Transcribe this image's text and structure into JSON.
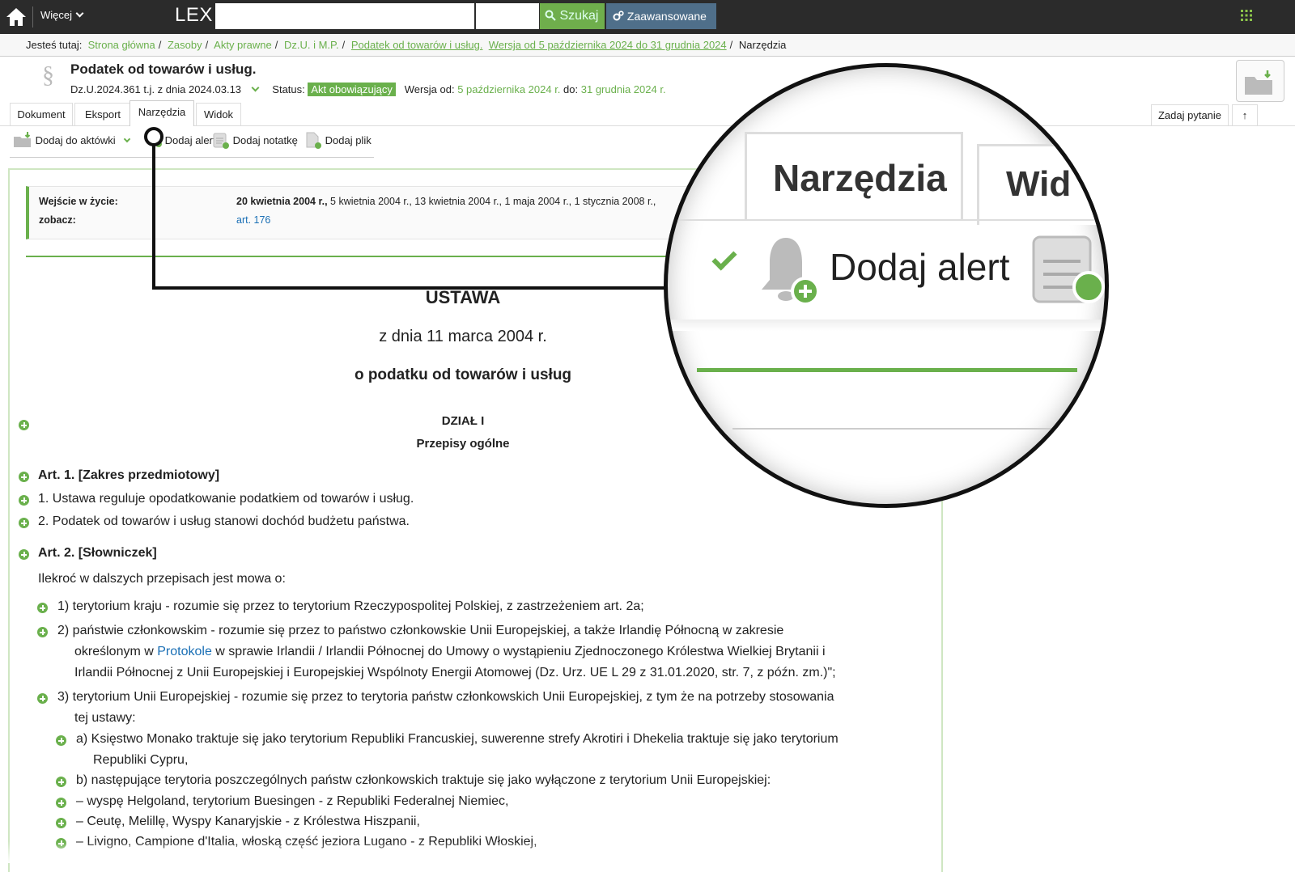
{
  "topbar": {
    "more": "Więcej",
    "brand": "LEX",
    "search_label": "Szukaj",
    "advanced_label": "Zaawansowane",
    "icons": [
      "home-icon",
      "search-icon",
      "gears-icon",
      "grid-icon"
    ]
  },
  "breadcrumb": {
    "prefix": "Jesteś tutaj:",
    "items": [
      "Strona główna",
      "Zasoby",
      "Akty prawne",
      "Dz.U. i M.P.",
      "Podatek od towarów i usług.",
      "Wersja od 5 października 2024 do 31 grudnia 2024",
      "Narzędzia"
    ]
  },
  "doc": {
    "title": "Podatek od towarów i usług.",
    "ref": "Dz.U.2024.361 t.j. z dnia 2024.03.13",
    "status_label": "Status:",
    "status": "Akt obowiązujący",
    "version_label": "Wersja od:",
    "version_from": "5 października 2024 r.",
    "to_label": "do:",
    "version_to": "31 grudnia 2024 r."
  },
  "tabs": [
    "Dokument",
    "Eksport",
    "Narzędzia",
    "Widok"
  ],
  "active_tab": "Narzędzia",
  "right_tabs": {
    "ask": "Zadaj pytanie",
    "up": "↑"
  },
  "tools": [
    "Dodaj do aktówki",
    "Dodaj alert",
    "Dodaj notatkę",
    "Dodaj plik"
  ],
  "info": {
    "entry_label": "Wejście w życie:",
    "entry_bold": "20 kwietnia 2004 r.,",
    "entry_rest": " 5 kwietnia 2004 r., 13 kwietnia 2004 r., 1 maja 2004 r., 1 stycznia 2008 r.,",
    "see_label": "zobacz:",
    "see_link": "art. 176"
  },
  "act": {
    "kind": "USTAWA",
    "date": "z dnia 11 marca 2004 r.",
    "subject": "o podatku od towarów i usług",
    "division": "DZIAŁ  I",
    "division_title": "Przepisy ogólne"
  },
  "art1": {
    "head": "Art.  1.   [Zakres przedmiotowy]",
    "p1": "1.   Ustawa reguluje opodatkowanie podatkiem od towarów i usług.",
    "p2": "2.   Podatek od towarów i usług stanowi dochód budżetu państwa."
  },
  "art2": {
    "head": "Art.  2.   [Słowniczek]",
    "intro": "Ilekroć w dalszych przepisach jest mowa o:",
    "i1": "1)  terytorium kraju - rozumie się przez to terytorium Rzeczypospolitej Polskiej, z zastrzeżeniem art. 2a;",
    "i2a": "2)  państwie członkowskim - rozumie się przez to państwo członkowskie Unii Europejskiej, a także Irlandię Północną w zakresie",
    "i2b_pre": "określonym w ",
    "i2b_link": "Protokole",
    "i2b_post": " w sprawie Irlandii / Irlandii Północnej do Umowy o wystąpieniu Zjednoczonego Królestwa Wielkiej Brytanii i",
    "i2c": "Irlandii Północnej z Unii Europejskiej i Europejskiej Wspólnoty Energii Atomowej (Dz. Urz. UE L 29 z 31.01.2020, str. 7, z późn. zm.)\";",
    "i3a": "3)  terytorium Unii Europejskiej - rozumie się przez to terytoria państw członkowskich Unii Europejskiej, z tym że na potrzeby stosowania",
    "i3b": "tej ustawy:",
    "a1": "a)  Księstwo Monako traktuje się jako terytorium Republiki Francuskiej, suwerenne strefy Akrotiri i Dhekelia traktuje się jako terytorium",
    "a2": "Republiki Cypru,",
    "b1": "b)  następujące terytoria poszczególnych państw członkowskich traktuje się jako wyłączone z terytorium Unii Europejskiej:",
    "d1": "–  wyspę Helgoland, terytorium Buesingen - z Republiki Federalnej Niemiec,",
    "d2": "–  Ceutę, Melillę, Wyspy Kanaryjskie - z Królestwa Hiszpanii,",
    "d3": "–  Livigno, Campione d'Italia, włoską część jeziora Lugano - z Republiki Włoskiej,"
  },
  "magnifier": {
    "tab_active": "Narzędzia",
    "tab_next": "Wid",
    "action": "Dodaj alert"
  },
  "colors": {
    "accent": "#6ab04c",
    "topbar": "#2b2b2b",
    "search_btn": "#6fae4c",
    "advanced_btn": "#4f6f8a",
    "link": "#1a6fb5"
  }
}
